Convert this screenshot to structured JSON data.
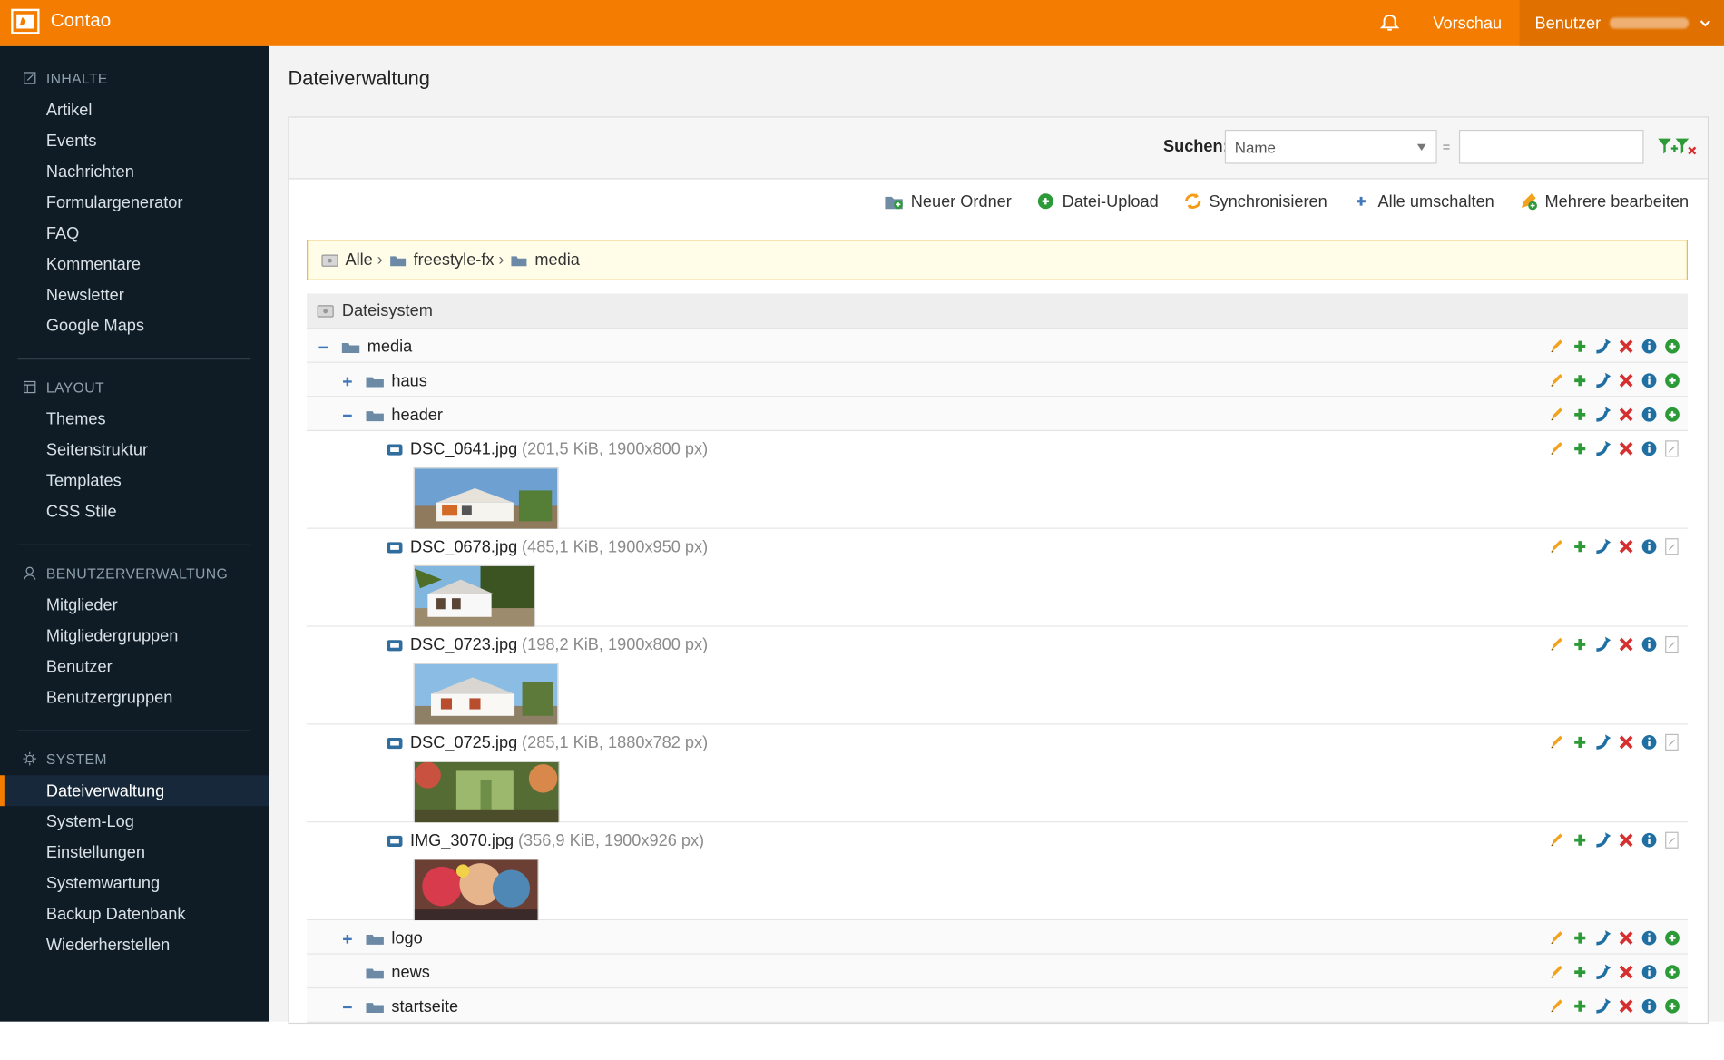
{
  "app": {
    "name": "Contao",
    "top": {
      "preview_label": "Vorschau",
      "user_label": "Benutzer"
    }
  },
  "sidebar": {
    "groups": [
      {
        "title": "INHALTE",
        "icon": "edit-icon",
        "items": [
          "Artikel",
          "Events",
          "Nachrichten",
          "Formulargenerator",
          "FAQ",
          "Kommentare",
          "Newsletter",
          "Google Maps"
        ]
      },
      {
        "title": "LAYOUT",
        "icon": "layout-icon",
        "items": [
          "Themes",
          "Seitenstruktur",
          "Templates",
          "CSS Stile"
        ]
      },
      {
        "title": "BENUTZERVERWALTUNG",
        "icon": "user-icon",
        "items": [
          "Mitglieder",
          "Mitgliedergruppen",
          "Benutzer",
          "Benutzergruppen"
        ]
      },
      {
        "title": "SYSTEM",
        "icon": "gear-icon",
        "items": [
          "Dateiverwaltung",
          "System-Log",
          "Einstellungen",
          "Systemwartung",
          "Backup Datenbank",
          "Wiederherstellen"
        ]
      }
    ],
    "active_item": "Dateiverwaltung"
  },
  "page": {
    "title": "Dateiverwaltung",
    "search_label": "Suchen:",
    "search_field": "Name",
    "equals": "=",
    "search_value": "",
    "toolbar": [
      "Neuer Ordner",
      "Datei-Upload",
      "Synchronisieren",
      "Alle umschalten",
      "Mehrere bearbeiten"
    ],
    "breadcrumb": [
      "Alle",
      "freestyle-fx",
      "media"
    ]
  },
  "tree": {
    "root": "Dateisystem",
    "rows": [
      {
        "type": "folder",
        "name": "media",
        "toggle": "minus",
        "level": 0
      },
      {
        "type": "folder",
        "name": "haus",
        "toggle": "plus",
        "level": 1
      },
      {
        "type": "folder",
        "name": "header",
        "toggle": "minus",
        "level": 1
      },
      {
        "type": "file",
        "name": "DSC_0641.jpg",
        "meta": "(201,5 KiB, 1900x800 px)",
        "level": 2,
        "thumb": "house-orange"
      },
      {
        "type": "file",
        "name": "DSC_0678.jpg",
        "meta": "(485,1 KiB, 1900x950 px)",
        "level": 2,
        "thumb": "house-palm"
      },
      {
        "type": "file",
        "name": "DSC_0723.jpg",
        "meta": "(198,2 KiB, 1900x800 px)",
        "level": 2,
        "thumb": "house-white"
      },
      {
        "type": "file",
        "name": "DSC_0725.jpg",
        "meta": "(285,1 KiB, 1880x782 px)",
        "level": 2,
        "thumb": "garden"
      },
      {
        "type": "file",
        "name": "IMG_3070.jpg",
        "meta": "(356,9 KiB, 1900x926 px)",
        "level": 2,
        "thumb": "colorful"
      },
      {
        "type": "folder",
        "name": "logo",
        "toggle": "plus",
        "level": 1
      },
      {
        "type": "folder",
        "name": "news",
        "toggle": "none",
        "level": 1
      },
      {
        "type": "folder",
        "name": "startseite",
        "toggle": "minus",
        "level": 1
      }
    ]
  }
}
